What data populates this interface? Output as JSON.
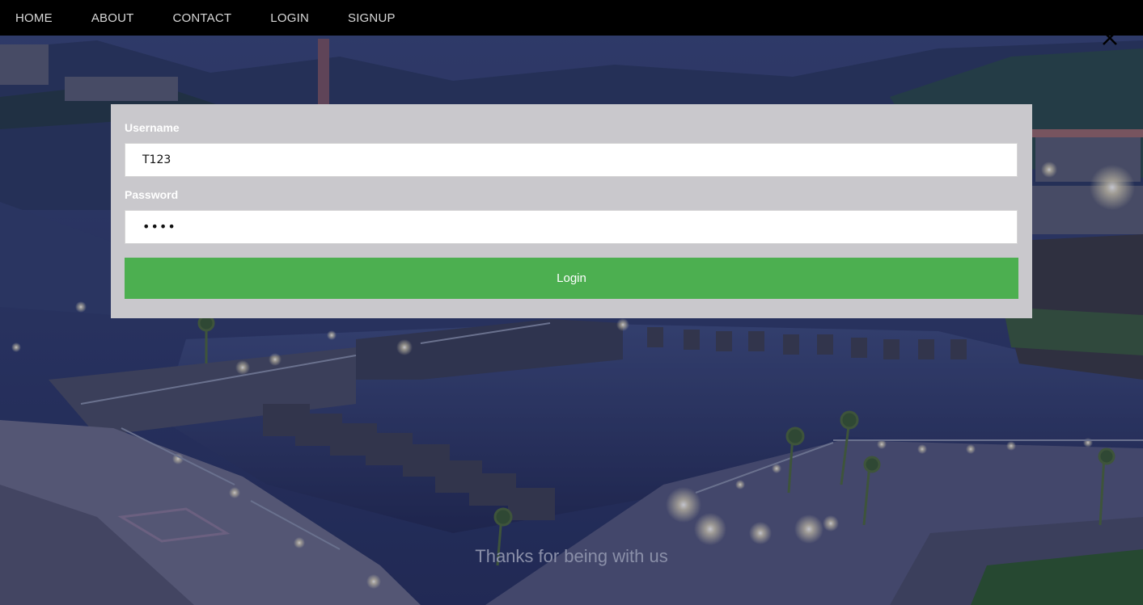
{
  "nav": {
    "items": [
      "HOME",
      "ABOUT",
      "CONTACT",
      "LOGIN",
      "SIGNUP"
    ]
  },
  "close": {
    "icon": "close-icon"
  },
  "form": {
    "username_label": "Username",
    "username_value": "T123",
    "password_label": "Password",
    "password_value": "••••",
    "login_label": "Login"
  },
  "footer": {
    "text": "Thanks for being with us"
  },
  "colors": {
    "navbar": "#000000",
    "modal": "#c9c8cc",
    "button": "#4caf50",
    "overlay": "#1c2348"
  }
}
